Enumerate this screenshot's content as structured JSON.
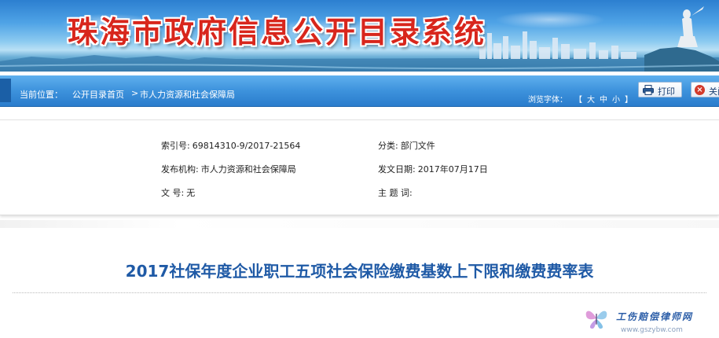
{
  "banner": {
    "title": "珠海市政府信息公开目录系统"
  },
  "navbar": {
    "location_label": "当前位置：",
    "breadcrumb": [
      "公开目录首页",
      "市人力资源和社会保障局"
    ],
    "separator": ">",
    "font_label": "浏览字体：",
    "font_sizes": [
      "大",
      "中",
      "小"
    ],
    "print_label": "打印",
    "close_label": "关闭"
  },
  "meta": {
    "index_label": "索引号:",
    "index_value": "69814310-9/2017-21564",
    "category_label": "分类:",
    "category_value": "部门文件",
    "publisher_label": "发布机构:",
    "publisher_value": "市人力资源和社会保障局",
    "date_label": "发文日期:",
    "date_value": "2017年07月17日",
    "docno_label": "文 号:",
    "docno_value": "无",
    "subject_label": "主 题 词:",
    "subject_value": ""
  },
  "document": {
    "title": "2017社保年度企业职工五项社会保险缴费基数上下限和缴费费率表"
  },
  "watermark": {
    "text": "工伤赔偿律师网",
    "url": "www.gszybw.com"
  },
  "colors": {
    "banner_title": "#d8261c",
    "nav_blue": "#3d92dc",
    "doc_title": "#1f5aa6"
  }
}
